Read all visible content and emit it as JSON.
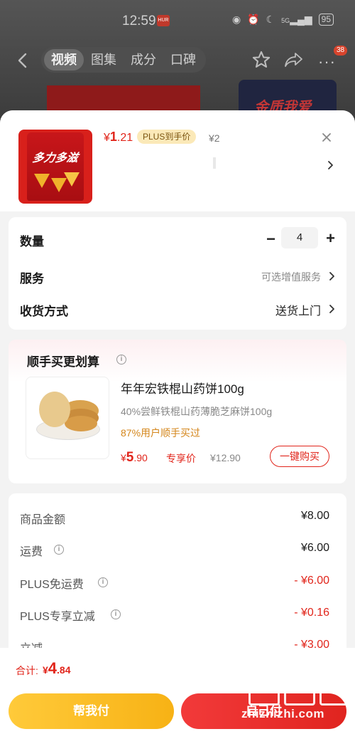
{
  "status_bar": {
    "time": "12:59",
    "badge": "HUR",
    "signal": "5G",
    "battery": "95"
  },
  "topnav": {
    "tabs": [
      {
        "label": "视频"
      },
      {
        "label": "图集"
      },
      {
        "label": "成分"
      },
      {
        "label": "口碑"
      }
    ],
    "cart_count": "38"
  },
  "background": {
    "thumb_text": "金质我爱"
  },
  "product": {
    "brand_text": "多力多滋",
    "price_symbol": "¥",
    "price_main": "1",
    "price_decimal": ".21",
    "plus_tag": "PLUS到手价",
    "original_price": "¥2"
  },
  "options": {
    "quantity_label": "数量",
    "quantity_value": "4",
    "minus": "−",
    "plus": "+",
    "service_label": "服务",
    "service_value": "可选增值服务",
    "delivery_label": "收货方式",
    "delivery_value": "送货上门"
  },
  "recommend": {
    "title": "顺手买更划算",
    "info": "i",
    "name": "年年宏铁棍山药饼100g",
    "desc": "40%尝鲜铁棍山药薄脆芝麻饼100g",
    "bought": "87%用户顺手买过",
    "price_symbol": "¥",
    "price_main": "5",
    "price_decimal": ".90",
    "price_label": "专享价",
    "original_price": "¥12.90",
    "buy_button": "一键购买"
  },
  "fees": [
    {
      "label": "商品金额",
      "value": "¥8.00",
      "red": false,
      "info": false
    },
    {
      "label": "运费",
      "value": "¥6.00",
      "red": false,
      "info": true
    },
    {
      "label": "PLUS免运费",
      "value": "- ¥6.00",
      "red": true,
      "info": true
    },
    {
      "label": "PLUS专享立减",
      "value": "- ¥0.16",
      "red": true,
      "info": true
    },
    {
      "label": "立减",
      "value": "- ¥3.00",
      "red": true,
      "info": false
    }
  ],
  "footer": {
    "total_label": "合计:",
    "total_symbol": "¥",
    "total_main": "4",
    "total_decimal": ".84",
    "help_pay_button": "帮我付",
    "pay_button": "自己付"
  },
  "watermark": {
    "text": "zhizhizhi.com"
  },
  "colors": {
    "accent_red": "#e1251b",
    "plus_gold": "#fbe9b8",
    "help_yellow": "#f7b215"
  }
}
